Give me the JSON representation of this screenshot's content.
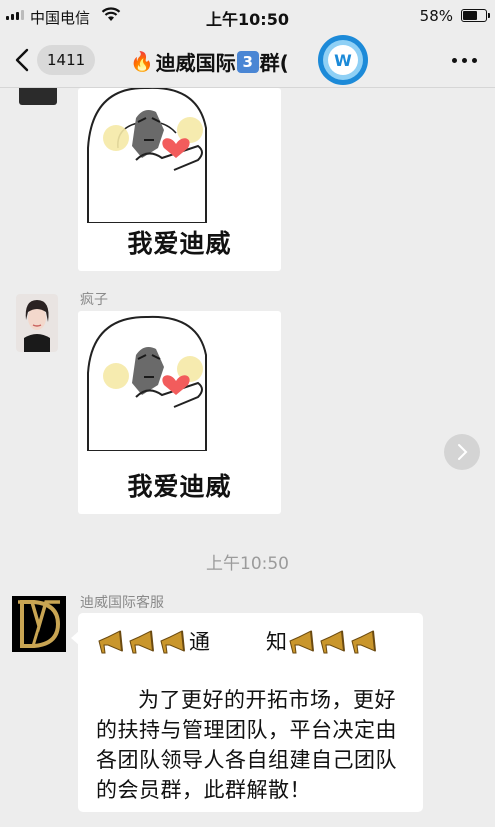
{
  "status_bar": {
    "carrier": "中国电信",
    "time": "上午10:50",
    "battery_pct": "58%",
    "battery_level": 0.58
  },
  "nav": {
    "back_count": "1411",
    "title_part1": "迪威国际",
    "title_num": "3",
    "title_part2": "群("
  },
  "messages": {
    "sticker_caption_1": "我爱迪威",
    "sender_2": "疯子",
    "sticker_caption_2": "我爱迪威",
    "timestamp": "上午10:50",
    "sender_3": "迪威国际客服",
    "notice_word_1": "通",
    "notice_word_2": "知",
    "notice_body": "为了更好的开拓市场，更好的扶持与管理团队，平台决定由各团队领导人各自组建自己团队的会员群，此群解散！"
  },
  "colors": {
    "background": "#ededed",
    "bubble": "#ffffff",
    "name_text": "#8a8a8a",
    "badge": "#d9d9d9"
  }
}
